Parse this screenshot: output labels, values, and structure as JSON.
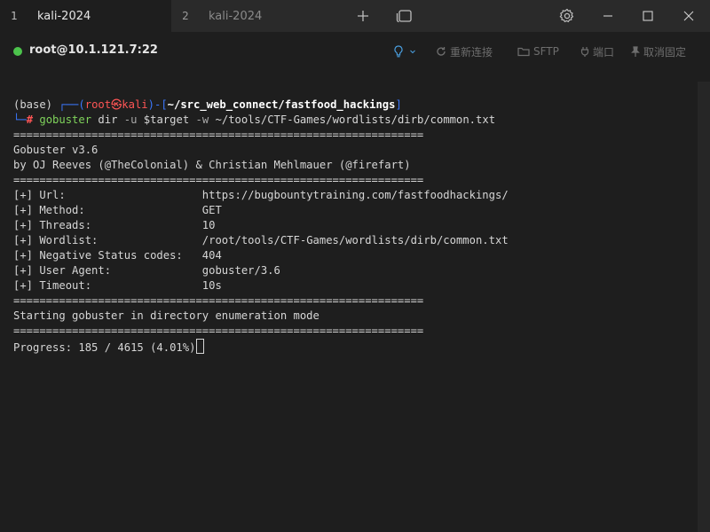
{
  "tabs": [
    {
      "number": "1",
      "label": "kali-2024"
    },
    {
      "number": "2",
      "label": "kali-2024"
    }
  ],
  "session": {
    "host": "root@10.1.121.7:22",
    "reconnect": "重新连接",
    "sftp": "SFTP",
    "port": "端口",
    "unpin": "取消固定"
  },
  "colors": {
    "status_connected": "#4cc34c",
    "prompt_blue": "#3b78ff",
    "prompt_red": "#ff5555",
    "command_green": "#7fd35b",
    "separator_gray": "#d6d6d6"
  },
  "terminal": {
    "prompt": {
      "env": "(base) ",
      "box_top": "┌──(",
      "user": "root",
      "at": "㉿",
      "hostname": "kali",
      "mid": ")-[",
      "cwd": "~/src_web_connect/fastfood_hackings",
      "close": "]",
      "box_bottom": "└─",
      "hash": "#",
      "cmd": "gobuster",
      "args1": " dir ",
      "flag_u": "-u",
      "args2": " $target ",
      "flag_w": "-w",
      "args3": " ~/tools/CTF-Games/wordlists/dirb/common.txt"
    },
    "separator": "===============================================================",
    "banner_title": "Gobuster v3.6",
    "banner_author": "by OJ Reeves (@TheColonial) & Christian Mehlmauer (@firefart)",
    "config": [
      {
        "key": "[+] Url:                     ",
        "value": "https://bugbountytraining.com/fastfoodhackings/"
      },
      {
        "key": "[+] Method:                  ",
        "value": "GET"
      },
      {
        "key": "[+] Threads:                 ",
        "value": "10"
      },
      {
        "key": "[+] Wordlist:                ",
        "value": "/root/tools/CTF-Games/wordlists/dirb/common.txt"
      },
      {
        "key": "[+] Negative Status codes:   ",
        "value": "404"
      },
      {
        "key": "[+] User Agent:              ",
        "value": "gobuster/3.6"
      },
      {
        "key": "[+] Timeout:                 ",
        "value": "10s"
      }
    ],
    "mode_line": "Starting gobuster in directory enumeration mode",
    "progress": "Progress: 185 / 4615 (4.01%)"
  }
}
